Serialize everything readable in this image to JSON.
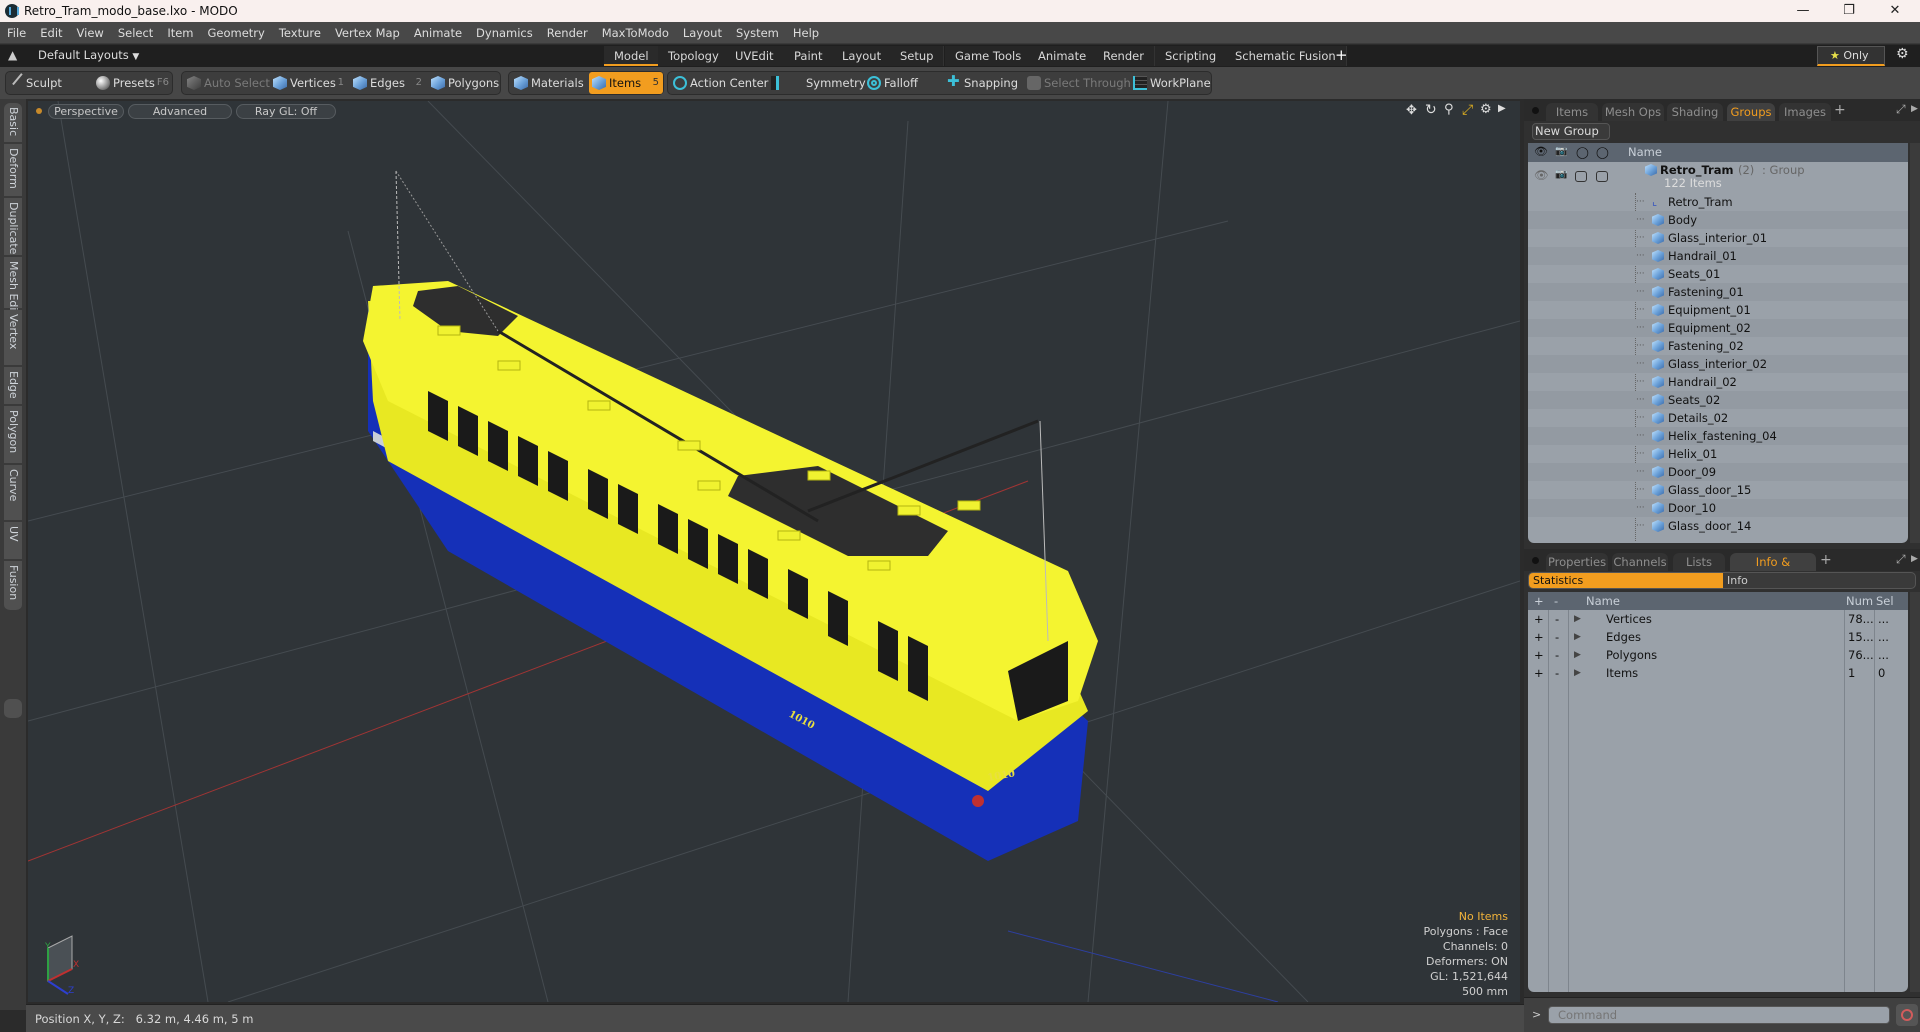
{
  "window": {
    "title": "Retro_Tram_modo_base.lxo - MODO",
    "controls": [
      "minimize",
      "maximize",
      "close"
    ]
  },
  "menu": [
    "File",
    "Edit",
    "View",
    "Select",
    "Item",
    "Geometry",
    "Texture",
    "Vertex Map",
    "Animate",
    "Dynamics",
    "Render",
    "MaxToModo",
    "Layout",
    "System",
    "Help"
  ],
  "layoutbar": {
    "layouts_label": "Default Layouts",
    "tabs": [
      "Model",
      "Topology",
      "UVEdit",
      "Paint",
      "Layout",
      "Setup",
      "Game Tools",
      "Animate",
      "Render",
      "Scripting",
      "Schematic Fusion"
    ],
    "active_tab": "Model",
    "only_label": "Only"
  },
  "toolbar": {
    "sculpt": "Sculpt",
    "presets": "Presets",
    "presets_key": "F6",
    "auto_select": "Auto Select",
    "vertices": "Vertices",
    "vertices_key": "1",
    "edges": "Edges",
    "edges_key": "2",
    "polygons": "Polygons",
    "materials": "Materials",
    "items": "Items",
    "items_key": "5",
    "action_center": "Action Center",
    "symmetry": "Symmetry",
    "falloff": "Falloff",
    "snapping": "Snapping",
    "select_through": "Select Through",
    "workplane": "WorkPlane"
  },
  "left_tabs": [
    "Basic",
    "Deform",
    "Duplicate",
    "Mesh Edit",
    "Vertex",
    "Edge",
    "Polygon",
    "Curve",
    "UV",
    "Fusion"
  ],
  "viewport": {
    "view": "Perspective",
    "shading": "Advanced",
    "raygl": "Ray GL: Off",
    "info": {
      "selection": "No Items",
      "polygons": "Polygons : Face",
      "channels": "Channels: 0",
      "deformers": "Deformers: ON",
      "gl": "GL: 1,521,644",
      "scale": "500 mm"
    },
    "axis_labels": {
      "x": "X",
      "y": "Y",
      "z": "Z"
    },
    "model_number": "1010",
    "colors": {
      "roof": "#f2f02a",
      "body": "#1530b8",
      "stripe": "#c9cfd6"
    }
  },
  "statusbar": {
    "position": "Position X, Y, Z:   6.32 m, 4.46 m, 5 m"
  },
  "groups_panel": {
    "tabs": [
      "Items",
      "Mesh Ops",
      "Shading",
      "Groups",
      "Images"
    ],
    "active_tab": "Groups",
    "new_group": "New Group",
    "column_name": "Name",
    "group": {
      "name": "Retro_Tram",
      "count": "(2)",
      "type": ": Group",
      "items_count": "122 Items"
    },
    "items": [
      "Retro_Tram",
      "Body",
      "Glass_interior_01",
      "Handrail_01",
      "Seats_01",
      "Fastening_01",
      "Equipment_01",
      "Equipment_02",
      "Fastening_02",
      "Glass_interior_02",
      "Handrail_02",
      "Seats_02",
      "Details_02",
      "Helix_fastening_04",
      "Helix_01",
      "Door_09",
      "Glass_door_15",
      "Door_10",
      "Glass_door_14"
    ]
  },
  "stats_panel": {
    "tabs": [
      "Properties",
      "Channels",
      "Lists",
      "Info & Statistics"
    ],
    "active_tab": "Info & Statistics",
    "subtabs": [
      "Statistics",
      "Info"
    ],
    "active_subtab": "Statistics",
    "columns": {
      "plus": "+",
      "minus": "-",
      "name": "Name",
      "num": "Num",
      "sel": "Sel"
    },
    "rows": [
      {
        "name": "Vertices",
        "num": "78...",
        "sel": "..."
      },
      {
        "name": "Edges",
        "num": "15...",
        "sel": "..."
      },
      {
        "name": "Polygons",
        "num": "76...",
        "sel": "..."
      },
      {
        "name": "Items",
        "num": "1",
        "sel": "0"
      }
    ]
  },
  "command": {
    "prompt": ">",
    "placeholder": "Command"
  },
  "accent_color": "#f29d1f"
}
